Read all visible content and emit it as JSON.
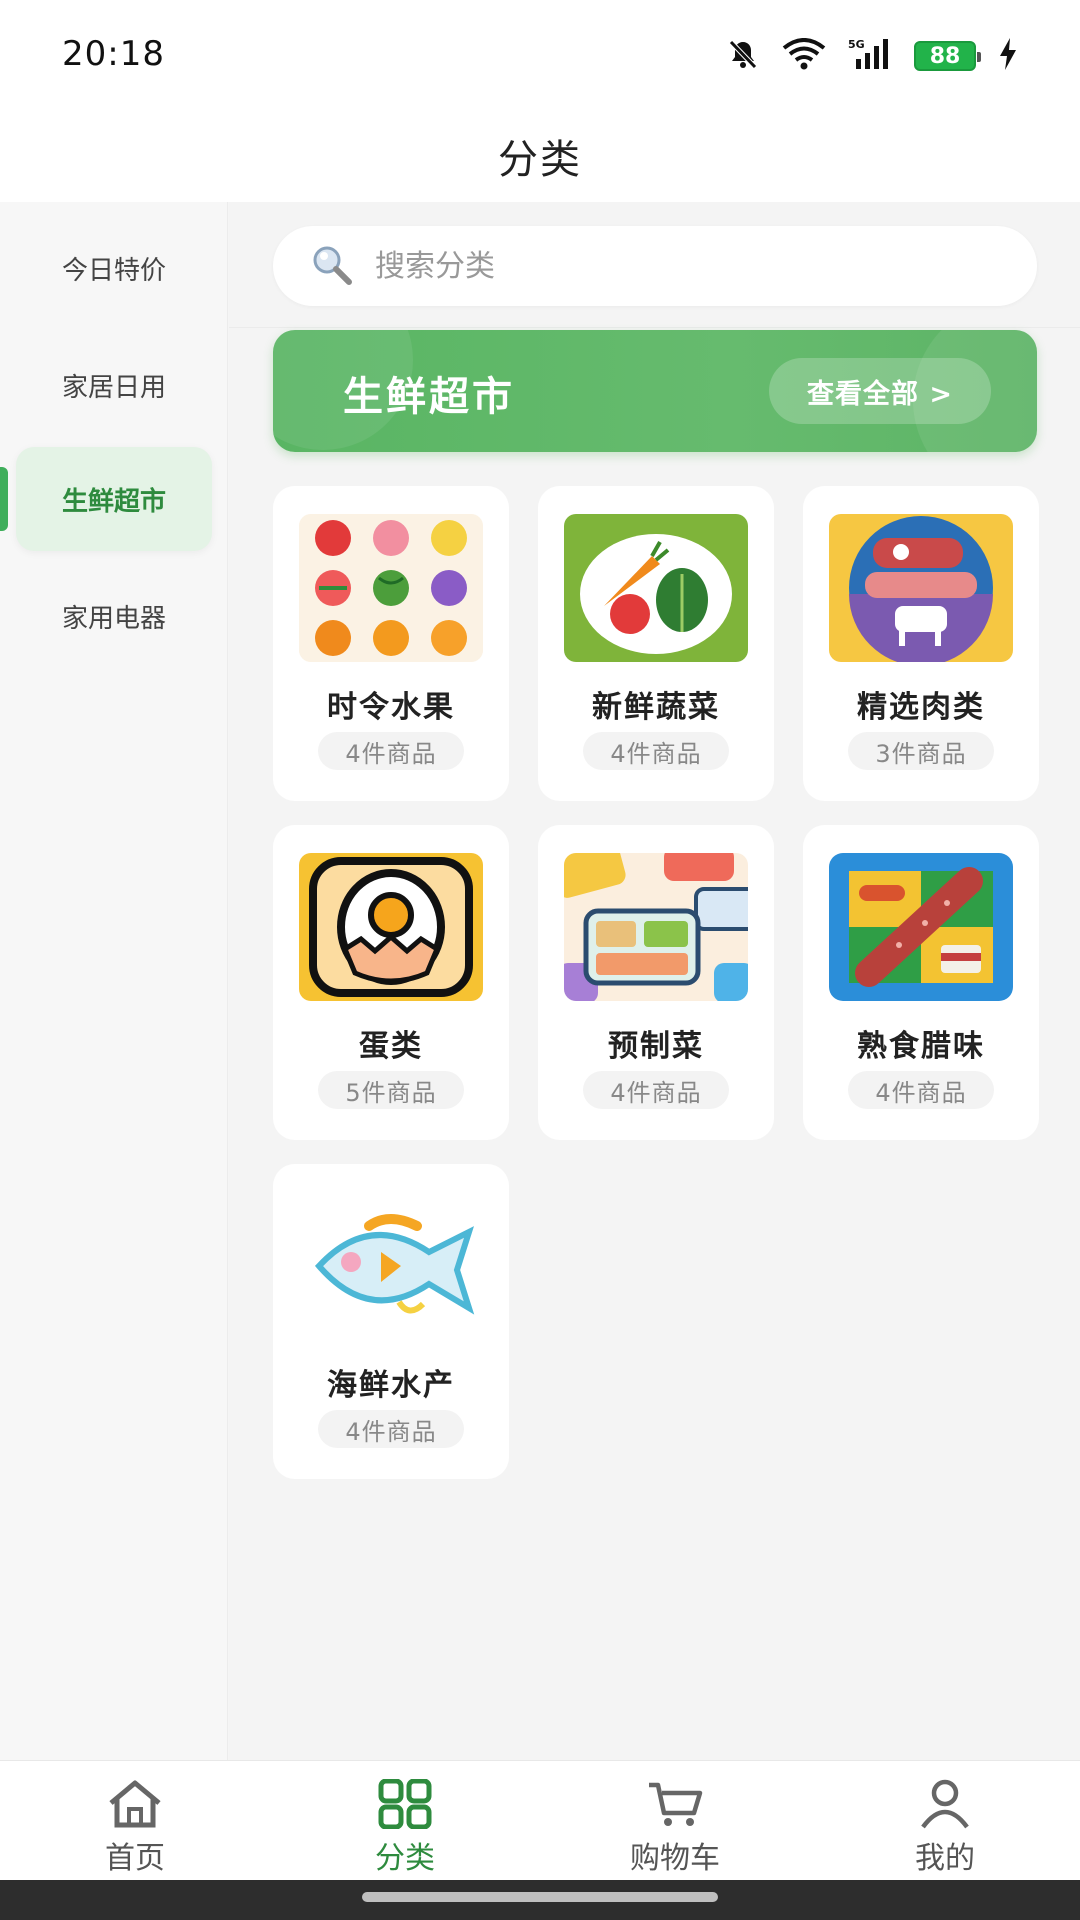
{
  "status_bar": {
    "time": "20:18",
    "battery": "88",
    "network": "5G"
  },
  "header": {
    "title": "分类"
  },
  "sidebar": {
    "items": [
      {
        "label": "今日特价"
      },
      {
        "label": "家居日用"
      },
      {
        "label": "生鲜超市",
        "active": true
      },
      {
        "label": "家用电器"
      }
    ]
  },
  "search": {
    "placeholder": "搜索分类"
  },
  "banner": {
    "title": "生鲜超市",
    "button_label": "查看全部 >"
  },
  "categories": [
    {
      "name": "时令水果",
      "count": "4件商品",
      "icon": "fruit-grid-icon"
    },
    {
      "name": "新鲜蔬菜",
      "count": "4件商品",
      "icon": "vegetable-plate-icon"
    },
    {
      "name": "精选肉类",
      "count": "3件商品",
      "icon": "meat-icon"
    },
    {
      "name": "蛋类",
      "count": "5件商品",
      "icon": "egg-icon"
    },
    {
      "name": "预制菜",
      "count": "4件商品",
      "icon": "bento-box-icon"
    },
    {
      "name": "熟食腊味",
      "count": "4件商品",
      "icon": "sausage-icon"
    },
    {
      "name": "海鲜水产",
      "count": "4件商品",
      "icon": "fish-icon"
    }
  ],
  "tabbar": {
    "items": [
      {
        "label": "首页",
        "icon": "home-icon"
      },
      {
        "label": "分类",
        "icon": "grid-icon",
        "active": true
      },
      {
        "label": "购物车",
        "icon": "cart-icon"
      },
      {
        "label": "我的",
        "icon": "user-icon"
      }
    ]
  },
  "colors": {
    "accent": "#2e8b3e",
    "banner": "#5cb564",
    "active_bg": "#e4f3e6"
  }
}
